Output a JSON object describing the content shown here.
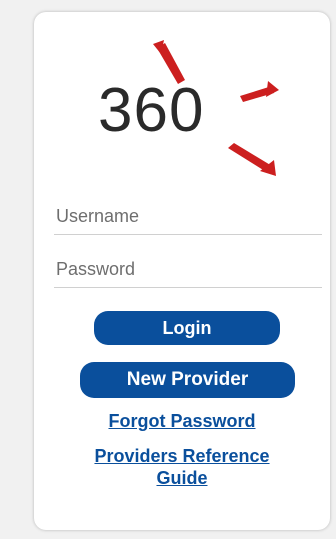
{
  "logo": {
    "text": "360",
    "mark_color": "#cc1f1f"
  },
  "form": {
    "username_placeholder": "Username",
    "password_placeholder": "Password"
  },
  "buttons": {
    "login_label": "Login",
    "new_provider_label": "New Provider"
  },
  "links": {
    "forgot_password": "Forgot Password",
    "reference_guide_line1": "Providers Reference",
    "reference_guide_line2": "Guide"
  },
  "colors": {
    "primary": "#0a4f9c",
    "accent": "#cc1f1f"
  }
}
